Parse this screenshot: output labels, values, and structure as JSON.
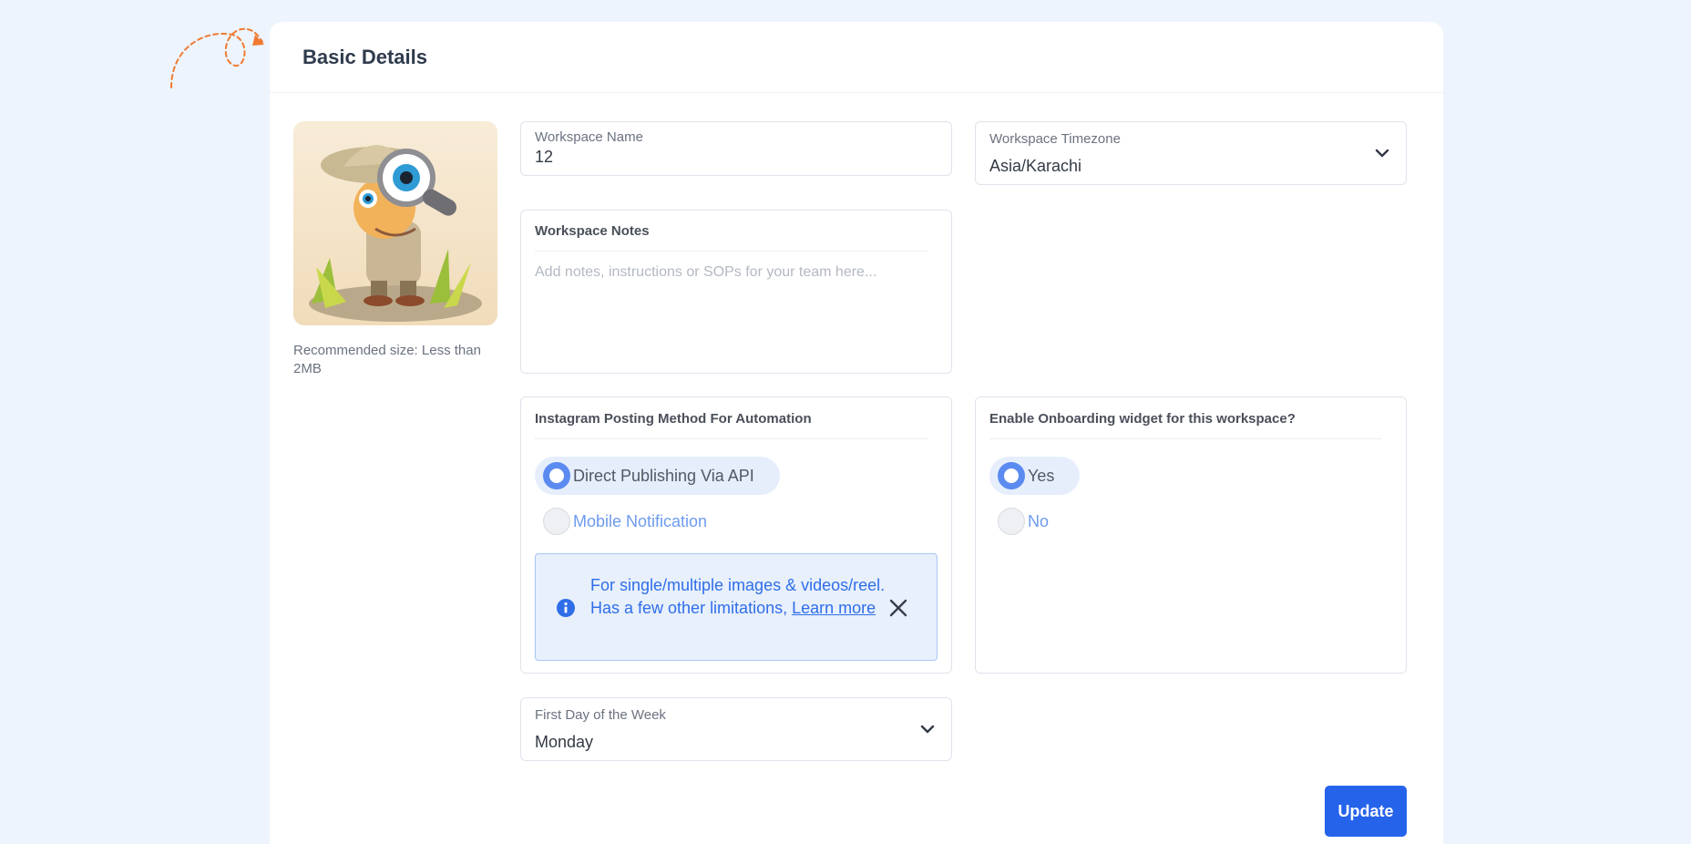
{
  "card": {
    "title": "Basic Details"
  },
  "avatar": {
    "caption": "Recommended size: Less than 2MB"
  },
  "workspace_name": {
    "label": "Workspace Name",
    "value": "12"
  },
  "workspace_timezone": {
    "label": "Workspace Timezone",
    "value": "Asia/Karachi"
  },
  "workspace_notes": {
    "title": "Workspace Notes",
    "placeholder": "Add notes, instructions or SOPs for your team here..."
  },
  "instagram": {
    "title": "Instagram Posting Method For Automation",
    "options": [
      {
        "label": "Direct Publishing Via API",
        "selected": true
      },
      {
        "label": "Mobile Notification",
        "selected": false
      }
    ],
    "info": {
      "text": "For single/multiple images & videos/reel. Has a few other limitations, ",
      "link": "Learn more"
    }
  },
  "onboarding": {
    "title": "Enable Onboarding widget for this workspace?",
    "options": [
      {
        "label": "Yes",
        "selected": true
      },
      {
        "label": "No",
        "selected": false
      }
    ]
  },
  "first_day": {
    "label": "First Day of the Week",
    "value": "Monday"
  },
  "actions": {
    "update_label": "Update"
  },
  "colors": {
    "accent": "#2563eb",
    "radio_on": "#5b8bf0",
    "info_bg": "#e8f0fc",
    "page_bg": "#edf4fd",
    "doodle": "#f07a32"
  }
}
